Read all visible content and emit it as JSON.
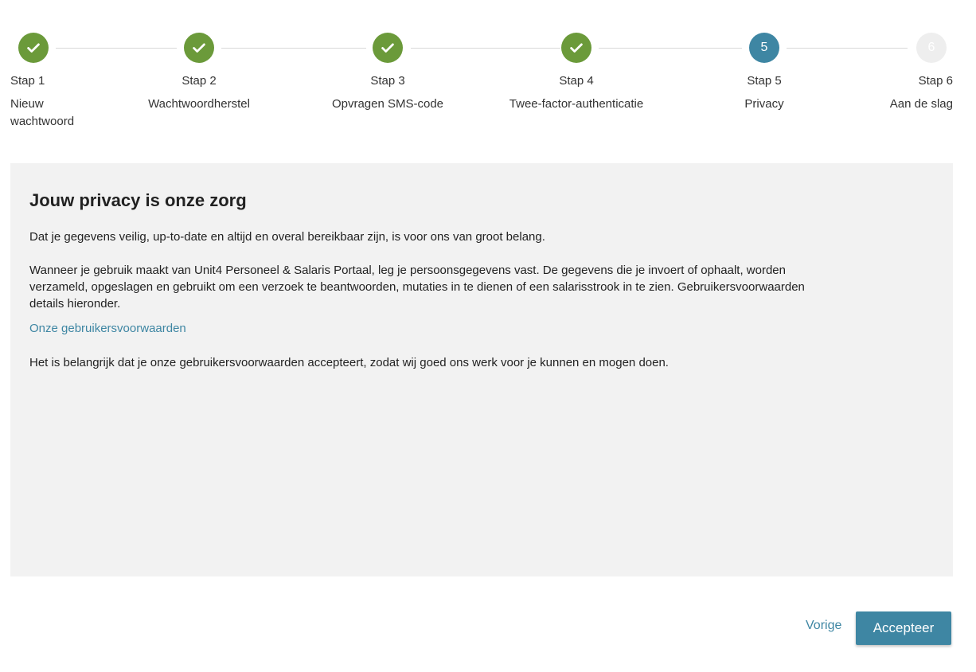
{
  "steps": [
    {
      "title": "Stap 1",
      "label": "Nieuw",
      "label2": "wachtwoord",
      "status": "done"
    },
    {
      "title": "Stap 2",
      "label": "Wachtwoordherstel",
      "status": "done"
    },
    {
      "title": "Stap 3",
      "label": "Opvragen SMS-code",
      "status": "done"
    },
    {
      "title": "Stap 4",
      "label": "Twee-factor-authenticatie",
      "status": "done"
    },
    {
      "title": "Stap 5",
      "label": "Privacy",
      "number": "5",
      "status": "active"
    },
    {
      "title": "Stap 6",
      "label": "Aan de slag",
      "number": "6",
      "status": "todo"
    }
  ],
  "icons": {
    "completed": "check-icon"
  },
  "panel": {
    "heading": "Jouw privacy is onze zorg",
    "para1": "Dat je gegevens veilig, up-to-date en altijd en overal bereikbaar zijn, is voor ons van groot belang.",
    "para2_line1": "Wanneer je gebruik maakt van Unit4 Personeel & Salaris Portaal, leg je persoonsgegevens vast. De gegevens die je invoert of ophaalt, worden",
    "para2_line2": "verzameld, opgeslagen en gebruikt om een verzoek te beantwoorden, mutaties in te dienen of een salarisstrook in te zien. Gebruikersvoorwaarden",
    "para2_line3": "details hieronder.",
    "terms_link": "Onze gebruikersvoorwaarden",
    "para3": "Het is belangrijk dat je onze gebruikersvoorwaarden accepteert, zodat wij goed ons werk voor je kunnen en mogen doen."
  },
  "footer": {
    "back_label": "Vorige",
    "accept_label": "Accepteer"
  },
  "colors": {
    "done": "#6b9a3a",
    "active": "#3e86a3",
    "todo": "#eeeeee",
    "panel_bg": "#f2f2f2"
  }
}
